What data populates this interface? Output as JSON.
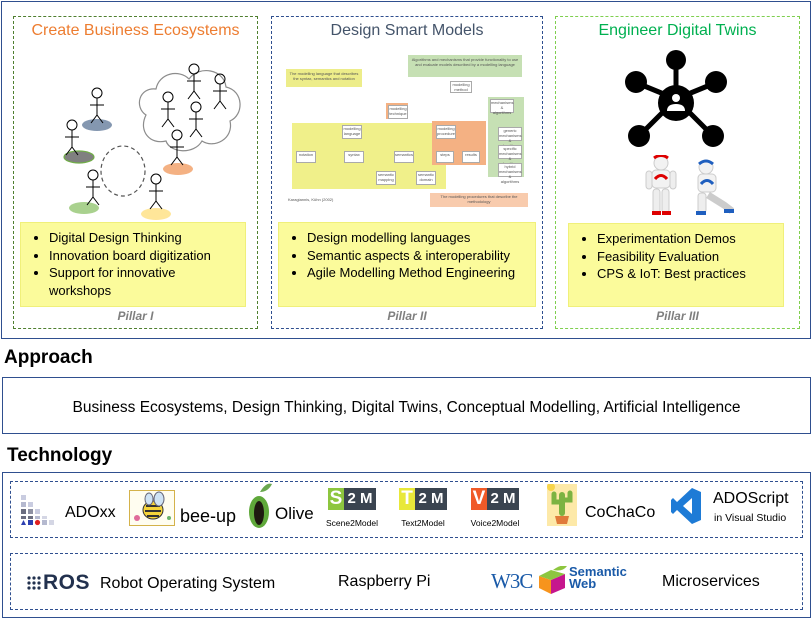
{
  "pillars": [
    {
      "title": "Create Business Ecosystems",
      "title_color": "#ed7d31",
      "bullets": [
        "Digital Design Thinking",
        "Innovation board digitization",
        "Support for innovative workshops"
      ],
      "label": "Pillar I",
      "illustration": "stick-figure-ecosystem-icon"
    },
    {
      "title": "Design Smart Models",
      "title_color": "#44546a",
      "bullets": [
        "Design modelling languages",
        "Semantic aspects & interoperability",
        "Agile Modelling Method Engineering"
      ],
      "label": "Pillar II",
      "illustration": "modelling-method-diagram",
      "diagram": {
        "note_language": "The modelling language that describes the syntax, semantics and notation",
        "note_algorithms": "Algorithms and mechanisms that provide functionality to use and evaluate models described by a modelling language",
        "note_procedures": "The modelling procedures that describe the methodology",
        "citation": "Karagiannis, Kühn (2002)",
        "nodes": [
          "modelling method",
          "modelling technique",
          "modelling language",
          "modelling procedure",
          "notation",
          "syntax",
          "semantics",
          "steps",
          "results",
          "semantic mapping",
          "semantic domain",
          "mechanisms & algorithms",
          "generic mechanisms & algorithms",
          "specific mechanisms & algorithms",
          "hybrid mechanisms & algorithms"
        ]
      }
    },
    {
      "title": "Engineer Digital Twins",
      "title_color": "#00b050",
      "bullets": [
        "Experimentation Demos",
        "Feasibility Evaluation",
        "CPS & IoT: Best practices"
      ],
      "label": "Pillar III",
      "illustration": "network-hub-icon"
    }
  ],
  "approach": {
    "heading": "Approach",
    "text": "Business Ecosystems, Design Thinking, Digital Twins, Conceptual Modelling, Artificial Intelligence"
  },
  "technology": {
    "heading": "Technology",
    "row1": [
      {
        "name": "ADOxx",
        "icon": "adoxx-logo-icon"
      },
      {
        "name": "bee-up",
        "icon": "bee-logo-icon"
      },
      {
        "name": "Olive",
        "icon": "olive-logo-icon"
      },
      {
        "name": "Scene2Model",
        "letter": "S",
        "color": "#8dc63f",
        "icon": "scene2model-logo-icon"
      },
      {
        "name": "Text2Model",
        "letter": "T",
        "color": "#e8e83a",
        "icon": "text2model-logo-icon"
      },
      {
        "name": "Voice2Model",
        "letter": "V",
        "color": "#f05a28",
        "icon": "voice2model-logo-icon"
      },
      {
        "name": "CoChaCo",
        "icon": "cactus-logo-icon"
      },
      {
        "name": "ADOScript",
        "sub": "in Visual Studio",
        "icon": "visual-studio-logo-icon"
      }
    ],
    "two_m": "2 M",
    "row2": [
      {
        "name": "ROS",
        "label": "Robot Operating System",
        "icon": "ros-logo-icon"
      },
      {
        "name": "Raspberry Pi"
      },
      {
        "name": "W3C",
        "label": "Semantic Web",
        "icon": "semantic-web-cube-icon"
      },
      {
        "name": "Microservices"
      }
    ]
  }
}
